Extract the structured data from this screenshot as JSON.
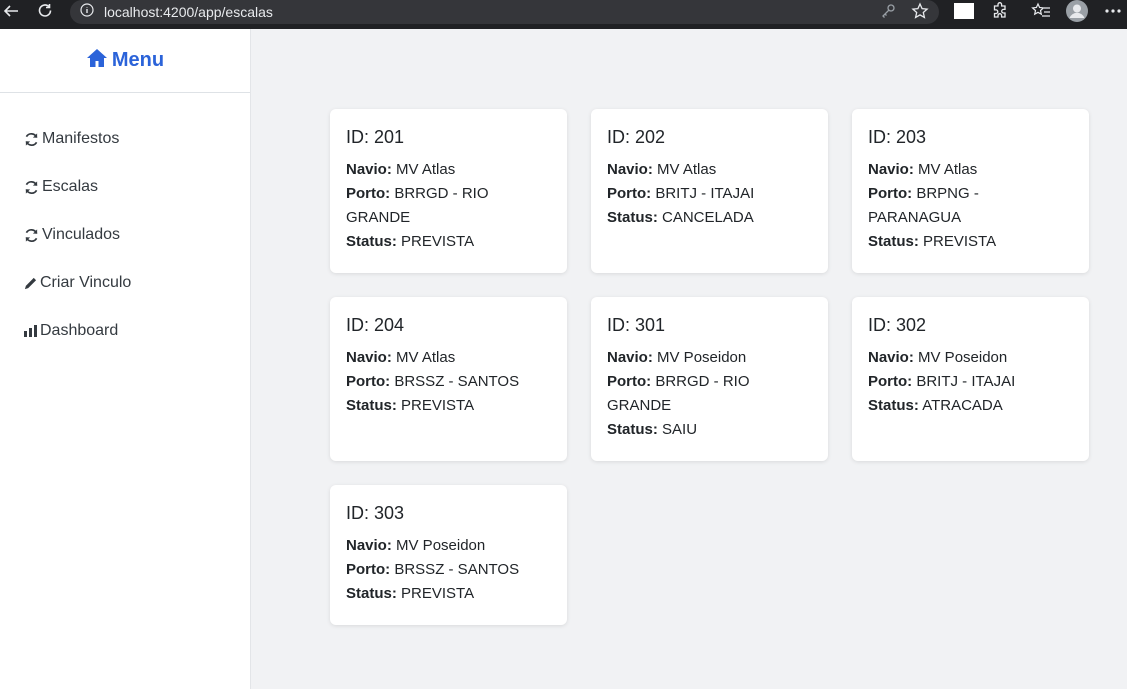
{
  "browser": {
    "url": "localhost:4200/app/escalas"
  },
  "sidebar": {
    "title": "Menu",
    "items": [
      {
        "label": "Manifestos",
        "icon": "refresh-icon"
      },
      {
        "label": "Escalas",
        "icon": "refresh-icon"
      },
      {
        "label": "Vinculados",
        "icon": "refresh-icon"
      },
      {
        "label": "Criar Vinculo",
        "icon": "pencil-icon"
      },
      {
        "label": "Dashboard",
        "icon": "bar-chart-icon"
      }
    ]
  },
  "labels": {
    "navio": "Navio:",
    "porto": "Porto:",
    "status": "Status:"
  },
  "escalas": [
    {
      "id": "ID: 201",
      "navio": "MV Atlas",
      "porto": "BRRGD - RIO GRANDE",
      "status": "PREVISTA"
    },
    {
      "id": "ID: 202",
      "navio": "MV Atlas",
      "porto": "BRITJ - ITAJAI",
      "status": "CANCELADA"
    },
    {
      "id": "ID: 203",
      "navio": "MV Atlas",
      "porto": "BRPNG - PARANAGUA",
      "status": "PREVISTA"
    },
    {
      "id": "ID: 204",
      "navio": "MV Atlas",
      "porto": "BRSSZ - SANTOS",
      "status": "PREVISTA"
    },
    {
      "id": "ID: 301",
      "navio": "MV Poseidon",
      "porto": "BRRGD - RIO GRANDE",
      "status": "SAIU"
    },
    {
      "id": "ID: 302",
      "navio": "MV Poseidon",
      "porto": "BRITJ - ITAJAI",
      "status": "ATRACADA"
    },
    {
      "id": "ID: 303",
      "navio": "MV Poseidon",
      "porto": "BRSSZ - SANTOS",
      "status": "PREVISTA"
    }
  ],
  "colors": {
    "accent": "#2b63d9",
    "page_bg": "#f1f2f4"
  }
}
